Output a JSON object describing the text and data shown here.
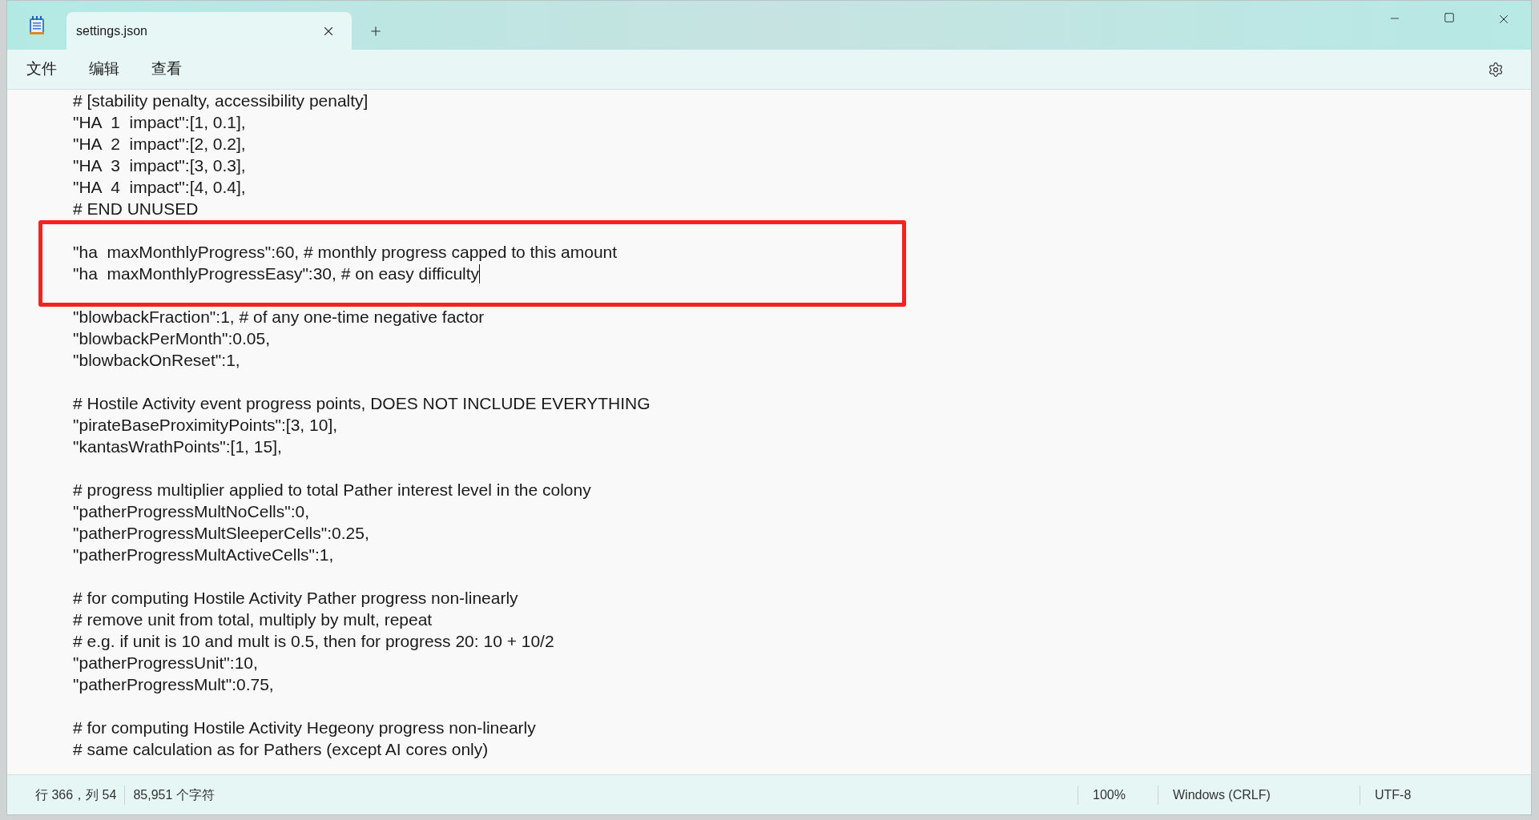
{
  "window": {
    "tab": {
      "title": "settings.json",
      "selected": true
    }
  },
  "menu": [
    "文件",
    "编辑",
    "查看"
  ],
  "editor": {
    "blocks": [
      {
        "highlighted": false,
        "lines": [
          {
            "text": "# [stability penalty, accessibility penalty]",
            "cursor": false
          },
          {
            "text": "\"HA  1  impact\":[1, 0.1],",
            "cursor": false
          },
          {
            "text": "\"HA  2  impact\":[2, 0.2],",
            "cursor": false
          },
          {
            "text": "\"HA  3  impact\":[3, 0.3],",
            "cursor": false
          },
          {
            "text": "\"HA  4  impact\":[4, 0.4],",
            "cursor": false
          },
          {
            "text": "# END UNUSED",
            "cursor": false
          }
        ]
      },
      {
        "highlighted": true,
        "lines": [
          {
            "text": "\"ha  maxMonthlyProgress\":60, # monthly progress capped to this amount",
            "cursor": false
          },
          {
            "text": "\"ha  maxMonthlyProgressEasy\":30, # on easy difficulty",
            "cursor": true
          }
        ]
      },
      {
        "highlighted": false,
        "lines": [
          {
            "text": "\"blowbackFraction\":1, # of any one-time negative factor",
            "cursor": false
          },
          {
            "text": "\"blowbackPerMonth\":0.05,",
            "cursor": false
          },
          {
            "text": "\"blowbackOnReset\":1,",
            "cursor": false
          }
        ]
      },
      {
        "highlighted": false,
        "lines": [
          {
            "text": "# Hostile Activity event progress points, DOES NOT INCLUDE EVERYTHING",
            "cursor": false
          },
          {
            "text": "\"pirateBaseProximityPoints\":[3, 10],",
            "cursor": false
          },
          {
            "text": "\"kantasWrathPoints\":[1, 15],",
            "cursor": false
          }
        ]
      },
      {
        "highlighted": false,
        "lines": [
          {
            "text": "# progress multiplier applied to total Pather interest level in the colony",
            "cursor": false
          },
          {
            "text": "\"patherProgressMultNoCells\":0,",
            "cursor": false
          },
          {
            "text": "\"patherProgressMultSleeperCells\":0.25,",
            "cursor": false
          },
          {
            "text": "\"patherProgressMultActiveCells\":1,",
            "cursor": false
          }
        ]
      },
      {
        "highlighted": false,
        "lines": [
          {
            "text": "# for computing Hostile Activity Pather progress non-linearly",
            "cursor": false
          },
          {
            "text": "# remove unit from total, multiply by mult, repeat",
            "cursor": false
          },
          {
            "text": "# e.g. if unit is 10 and mult is 0.5, then for progress 20: 10 + 10/2",
            "cursor": false
          },
          {
            "text": "\"patherProgressUnit\":10,",
            "cursor": false
          },
          {
            "text": "\"patherProgressMult\":0.75,",
            "cursor": false
          }
        ]
      },
      {
        "highlighted": false,
        "lines": [
          {
            "text": "# for computing Hostile Activity Hegeony progress non-linearly",
            "cursor": false
          },
          {
            "text": "# same calculation as for Pathers (except AI cores only)",
            "cursor": false
          }
        ]
      }
    ]
  },
  "status_bar": {
    "position": "行 366，列 54",
    "chars": "85,951 个字符",
    "zoom": "100%",
    "line_ending": "Windows (CRLF)",
    "encoding": "UTF-8"
  }
}
